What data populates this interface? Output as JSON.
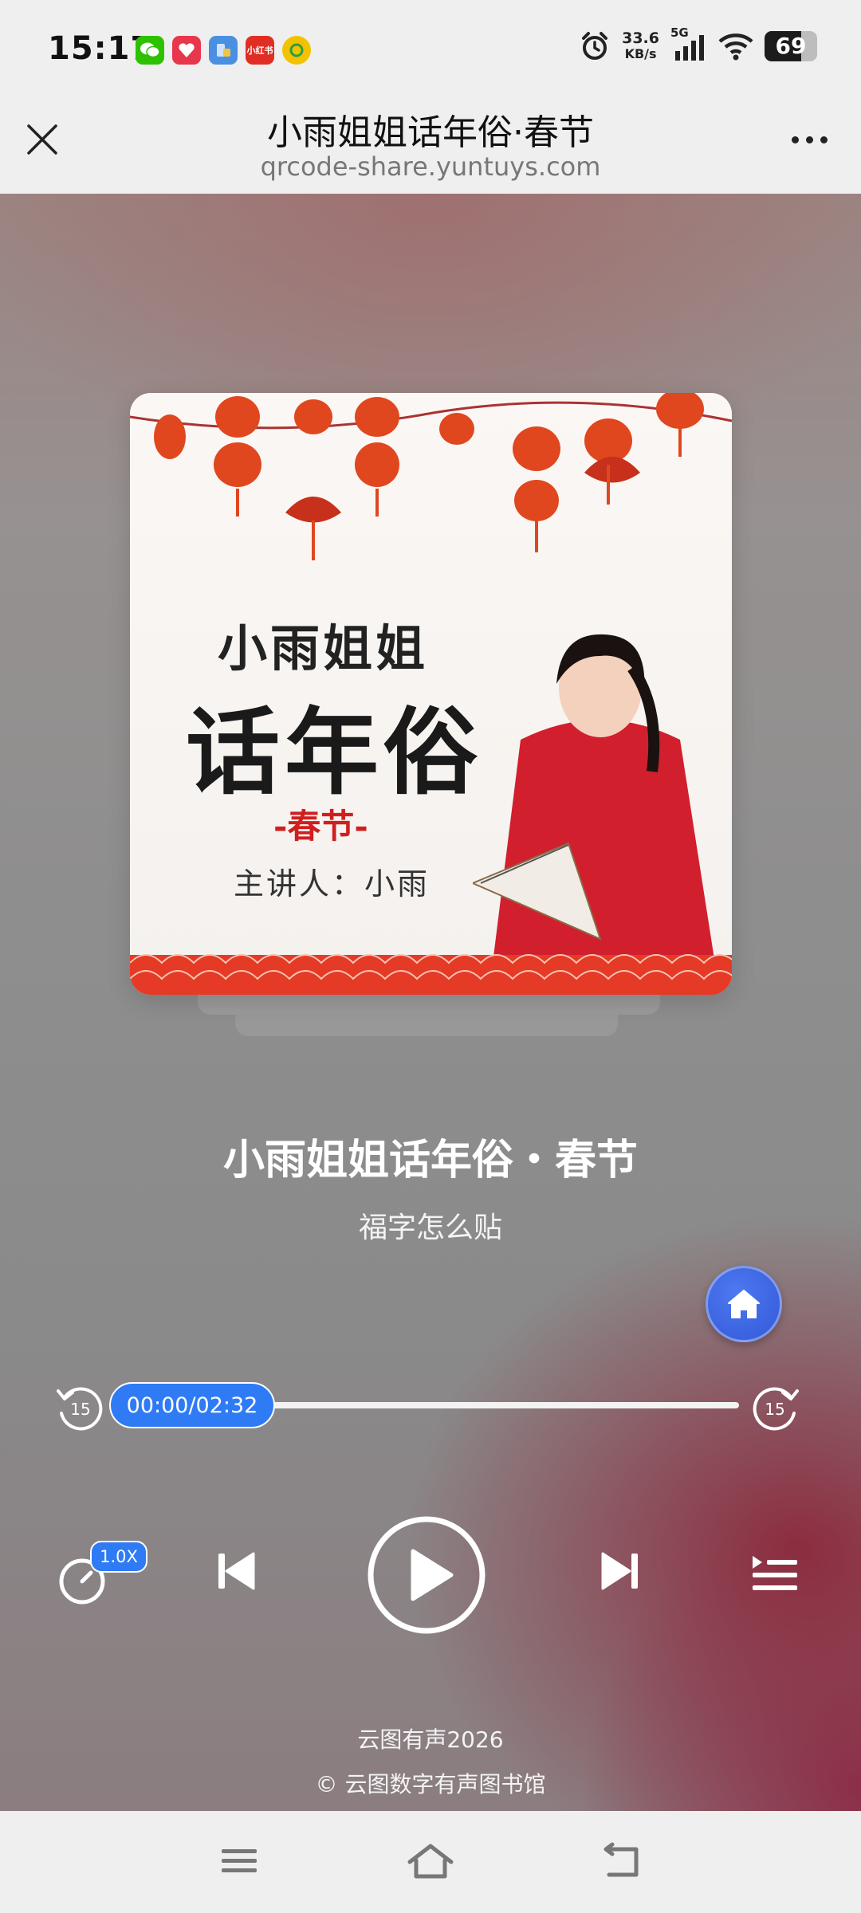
{
  "status_bar": {
    "time": "15:17",
    "app_icons": [
      {
        "name": "wechat-icon",
        "color": "#2dc100",
        "label": ""
      },
      {
        "name": "app-red-icon",
        "color": "#e8364c",
        "label": ""
      },
      {
        "name": "app-blue-icon",
        "color": "#4a90e2",
        "label": ""
      },
      {
        "name": "xiaohongshu-icon",
        "color": "#e02e24",
        "label": "小红书"
      },
      {
        "name": "app-yellow-icon",
        "color": "#f2c200",
        "label": ""
      }
    ],
    "net_speed_value": "33.6",
    "net_speed_unit": "KB/s",
    "network_type": "5G",
    "battery_level": "69",
    "battery_fraction": 0.69
  },
  "header": {
    "title": "小雨姐姐话年俗·春节",
    "url": "qrcode-share.yuntuys.com"
  },
  "cover": {
    "line1": "小雨姐姐",
    "line2": "话年俗",
    "line3": "-春节-",
    "line4": "主讲人：小雨"
  },
  "track": {
    "title": "小雨姐姐话年俗・春节",
    "subtitle": "福字怎么贴"
  },
  "player": {
    "skip_back_seconds": "15",
    "skip_forward_seconds": "15",
    "time_display": "00:00/02:32",
    "progress_fraction": 0,
    "speed": "1.0X",
    "accent_color": "#2f7bf5"
  },
  "footer": {
    "line1": "云图有声2026",
    "line2": "© 云图数字有声图书馆"
  }
}
